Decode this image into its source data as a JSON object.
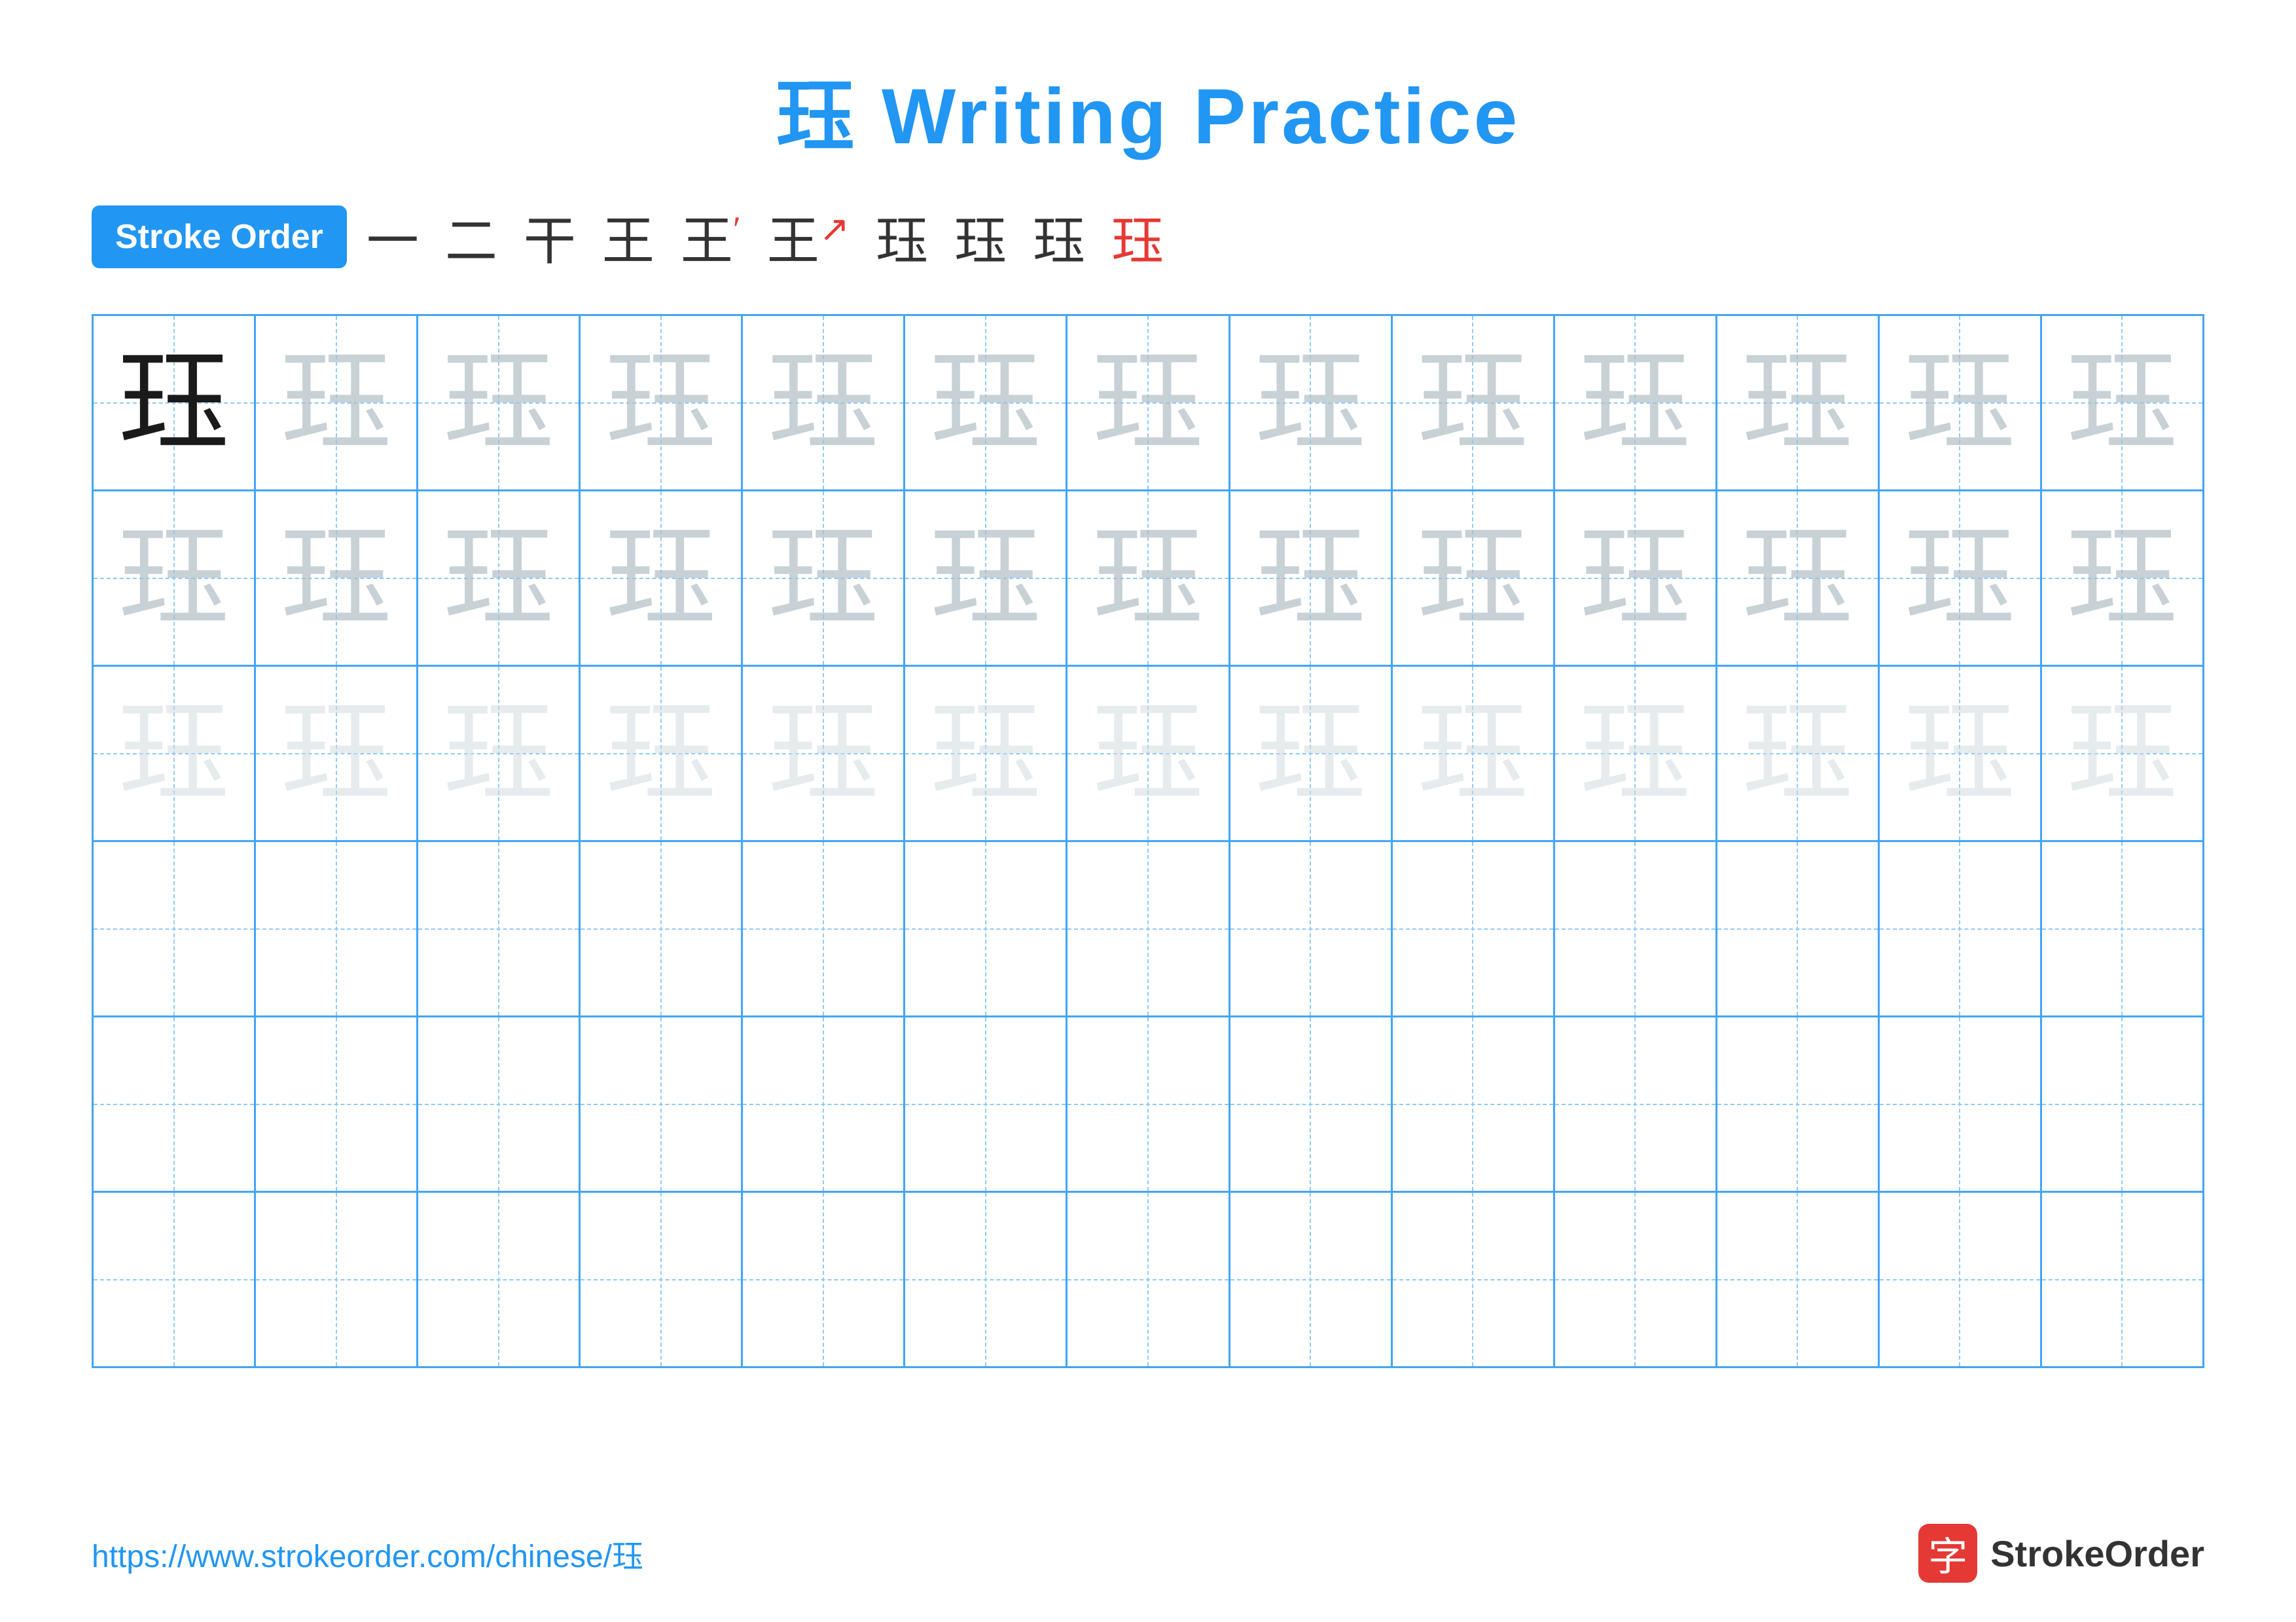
{
  "title": "珏 Writing Practice",
  "stroke_order": {
    "label": "Stroke Order",
    "strokes": [
      "一",
      "二",
      "干",
      "王",
      "王'",
      "王↗",
      "珏",
      "珏",
      "珏",
      "珏"
    ]
  },
  "character": "珏",
  "grid": {
    "rows": 6,
    "cols": 13
  },
  "row_styles": [
    "dark",
    "light1",
    "light2",
    "empty",
    "empty",
    "empty"
  ],
  "footer": {
    "url": "https://www.strokeorder.com/chinese/珏",
    "logo_char": "字",
    "logo_text": "StrokeOrder"
  }
}
